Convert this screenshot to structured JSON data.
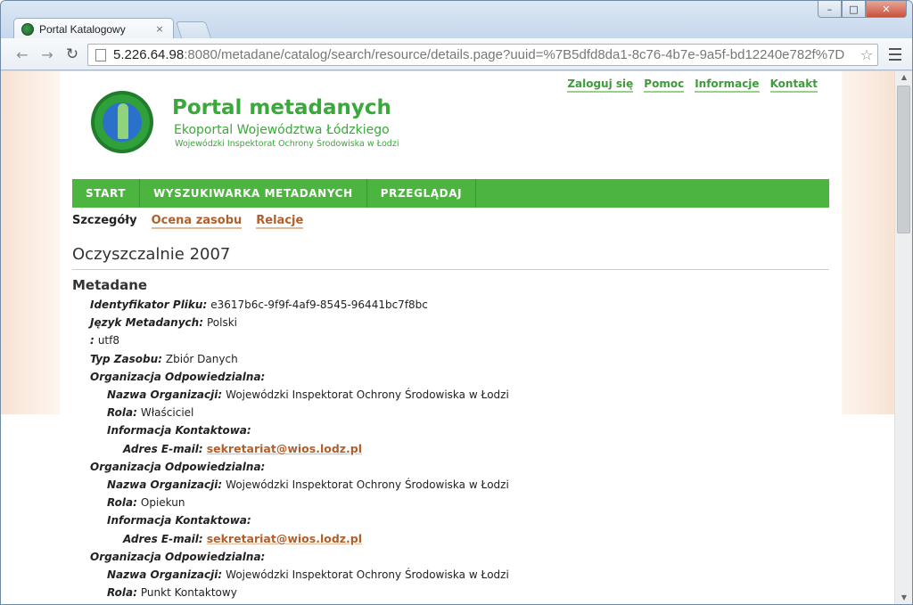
{
  "browser": {
    "tab_title": "Portal Katalogowy",
    "tab_close": "×",
    "url_host": "5.226.64.98",
    "url_rest": ":8080/metadane/catalog/search/resource/details.page?uuid=%7B5dfd8da1-8c76-4b7e-9a5f-bd12240e782f%7D",
    "back_glyph": "←",
    "forward_glyph": "→",
    "reload_glyph": "↻",
    "star_glyph": "☆",
    "window_min": "–",
    "window_max": "□",
    "window_close": "✕"
  },
  "header": {
    "top_links": [
      "Zaloguj się",
      "Pomoc",
      "Informacje",
      "Kontakt"
    ],
    "title": "Portal metadanych",
    "subtitle": "Ekoportal Województwa Łódzkiego",
    "institution": "Wojewódzki Inspektorat Ochrony Środowiska w Łodzi"
  },
  "nav": [
    "START",
    "WYSZUKIWARKA METADANYCH",
    "PRZEGLĄDAJ"
  ],
  "subtabs": {
    "active": "Szczegóły",
    "links": [
      "Ocena zasobu",
      "Relacje"
    ]
  },
  "record": {
    "title": "Oczyszczalnie 2007",
    "section": "Metadane",
    "fields": [
      {
        "indent": 1,
        "label": "Identyfikator Pliku:",
        "value": "e3617b6c-9f9f-4af9-8545-96441bc7f8bc"
      },
      {
        "indent": 1,
        "label": "Język Metadanych:",
        "value": "Polski"
      },
      {
        "indent": 1,
        "label": ":",
        "value": "utf8"
      },
      {
        "indent": 1,
        "label": "Typ Zasobu:",
        "value": "Zbiór Danych"
      },
      {
        "indent": 1,
        "label": "Organizacja Odpowiedzialna:",
        "value": ""
      },
      {
        "indent": 2,
        "label": "Nazwa Organizacji:",
        "value": "Wojewódzki Inspektorat Ochrony Środowiska w Łodzi"
      },
      {
        "indent": 2,
        "label": "Rola:",
        "value": "Właściciel"
      },
      {
        "indent": 2,
        "label": "Informacja Kontaktowa:",
        "value": ""
      },
      {
        "indent": 3,
        "label": "Adres E-mail:",
        "value": "sekretariat@wios.lodz.pl",
        "link": true
      },
      {
        "indent": 1,
        "label": "Organizacja Odpowiedzialna:",
        "value": ""
      },
      {
        "indent": 2,
        "label": "Nazwa Organizacji:",
        "value": "Wojewódzki Inspektorat Ochrony Środowiska w Łodzi"
      },
      {
        "indent": 2,
        "label": "Rola:",
        "value": "Opiekun"
      },
      {
        "indent": 2,
        "label": "Informacja Kontaktowa:",
        "value": ""
      },
      {
        "indent": 3,
        "label": "Adres E-mail:",
        "value": "sekretariat@wios.lodz.pl",
        "link": true
      },
      {
        "indent": 1,
        "label": "Organizacja Odpowiedzialna:",
        "value": ""
      },
      {
        "indent": 2,
        "label": "Nazwa Organizacji:",
        "value": "Wojewódzki Inspektorat Ochrony Środowiska w Łodzi"
      },
      {
        "indent": 2,
        "label": "Rola:",
        "value": "Punkt Kontaktowy"
      }
    ]
  },
  "colors": {
    "brand_green": "#4cb53f",
    "link_brown": "#b05f2b"
  }
}
